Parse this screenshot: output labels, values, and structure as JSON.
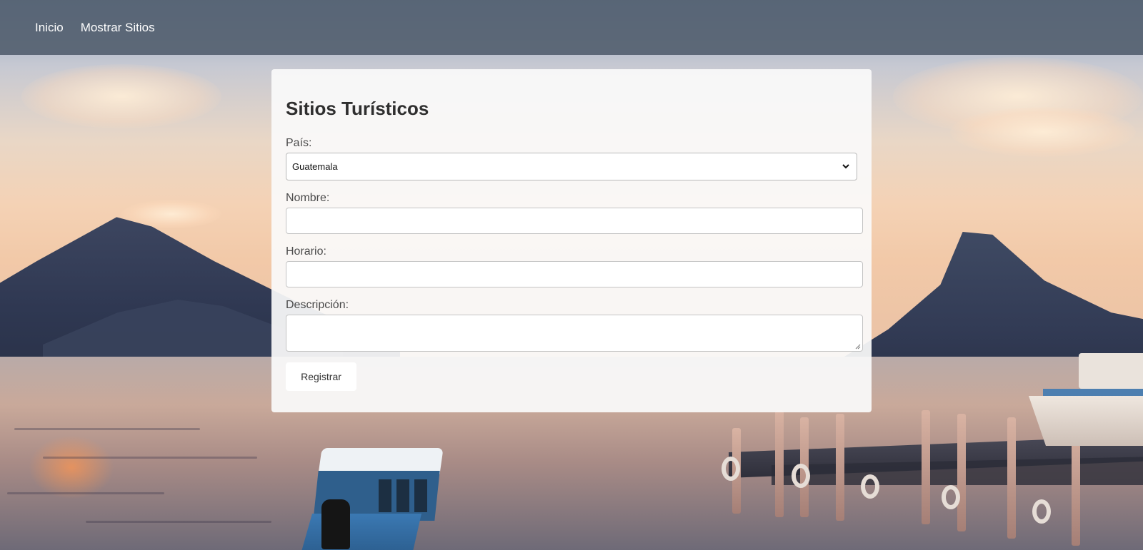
{
  "nav": {
    "items": [
      {
        "label": "Inicio"
      },
      {
        "label": "Mostrar Sitios"
      }
    ]
  },
  "form": {
    "title": "Sitios Turísticos",
    "pais": {
      "label": "País:",
      "selected": "Guatemala"
    },
    "nombre": {
      "label": "Nombre:",
      "value": ""
    },
    "horario": {
      "label": "Horario:",
      "value": ""
    },
    "descripcion": {
      "label": "Descripción:",
      "value": ""
    },
    "submit_label": "Registrar"
  },
  "colors": {
    "navbar": "#525e6e",
    "card": "#fafafa",
    "title": "#2f2f2f"
  }
}
